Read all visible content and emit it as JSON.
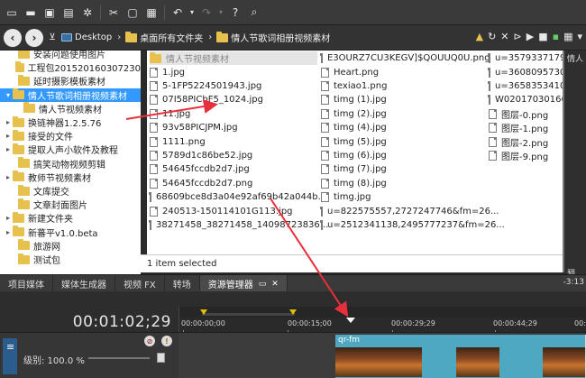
{
  "toolbar": {
    "icons": [
      "new-file-icon",
      "open-icon",
      "save-icon",
      "render-icon",
      "settings-icon",
      "cut-icon",
      "copy-icon",
      "paste-icon",
      "undo-icon",
      "redo-icon",
      "help-icon"
    ]
  },
  "nav": {
    "breadcrumbs": [
      {
        "label": "Desktop",
        "icon": "monitor-icon"
      },
      {
        "label": "桌面所有文件夹",
        "icon": "folder-icon"
      },
      {
        "label": "情人节歌词相册视频素材",
        "icon": "folder-icon"
      }
    ]
  },
  "tree": {
    "items": [
      {
        "label": "安装问题使用图片",
        "indent": 1,
        "arrow": ""
      },
      {
        "label": "工程包2015201603072​30",
        "indent": 1,
        "arrow": ""
      },
      {
        "label": "延时摄影模板素材",
        "indent": 1,
        "arrow": ""
      },
      {
        "label": "情人节歌词相册视频素材",
        "indent": 0,
        "arrow": "▾",
        "selected": true
      },
      {
        "label": "情人节视频素材",
        "indent": 2,
        "arrow": ""
      },
      {
        "label": "换链神器1.2.5.76",
        "indent": 0,
        "arrow": "▸"
      },
      {
        "label": "接受的文件",
        "indent": 0,
        "arrow": "▸"
      },
      {
        "label": "提取人声小软件及教程",
        "indent": 0,
        "arrow": "▸"
      },
      {
        "label": "搞笑动物视频剪辑",
        "indent": 1,
        "arrow": ""
      },
      {
        "label": "教师节视频素材",
        "indent": 0,
        "arrow": "▸"
      },
      {
        "label": "文库提交",
        "indent": 1,
        "arrow": ""
      },
      {
        "label": "文章封面图片",
        "indent": 1,
        "arrow": ""
      },
      {
        "label": "新建文件夹",
        "indent": 0,
        "arrow": "▸"
      },
      {
        "label": "新蕃平v1.0.beta",
        "indent": 0,
        "arrow": "▸"
      },
      {
        "label": "旅游网",
        "indent": 1,
        "arrow": ""
      },
      {
        "label": "测试包",
        "indent": 1,
        "arrow": ""
      }
    ]
  },
  "files": {
    "col1": [
      {
        "name": "情人节视频素材",
        "type": "folder",
        "selected": true
      },
      {
        "name": "1.jpg",
        "type": "file"
      },
      {
        "name": "5-1FP5224501943.jpg",
        "type": "file"
      },
      {
        "name": "07I58PICbF5_1024.jpg",
        "type": "file"
      },
      {
        "name": "11.jpg",
        "type": "file"
      },
      {
        "name": "93v58PICJPM.jpg",
        "type": "file"
      },
      {
        "name": "1111.png",
        "type": "file"
      },
      {
        "name": "5789d1c86be52.jpg",
        "type": "file"
      },
      {
        "name": "54645fccdb2d7.jpg",
        "type": "file"
      },
      {
        "name": "54645fccdb2d7.png",
        "type": "file"
      },
      {
        "name": "68609bce8d3a04e92af69b42a044b...",
        "type": "file"
      },
      {
        "name": "240513-150114101G113.jpg",
        "type": "file"
      },
      {
        "name": "38271458_38271458_14098723836...",
        "type": "file"
      }
    ],
    "col2": [
      {
        "name": "E3OURZ7CU3KEGV]$QOUUQ0U.png",
        "type": "file"
      },
      {
        "name": "Heart.png",
        "type": "file"
      },
      {
        "name": "texiao1.png",
        "type": "file"
      },
      {
        "name": "timg (1).jpg",
        "type": "file"
      },
      {
        "name": "timg (2).jpg",
        "type": "file"
      },
      {
        "name": "timg (4).jpg",
        "type": "file"
      },
      {
        "name": "timg (5).jpg",
        "type": "file"
      },
      {
        "name": "timg (6).jpg",
        "type": "file"
      },
      {
        "name": "timg (7).jpg",
        "type": "file"
      },
      {
        "name": "timg (8).jpg",
        "type": "file"
      },
      {
        "name": "timg.jpg",
        "type": "file"
      },
      {
        "name": "u=822575557,2727247746&fm=26...",
        "type": "file"
      },
      {
        "name": "u=2512341138,2495777237&fm=26...",
        "type": "file"
      }
    ],
    "col3": [
      {
        "name": "u=3579337179,",
        "type": "file"
      },
      {
        "name": "u=3608095730,",
        "type": "file"
      },
      {
        "name": "u=3658353410,",
        "type": "file"
      },
      {
        "name": "W02017030166",
        "type": "file"
      },
      {
        "name": "图层-0.png",
        "type": "file"
      },
      {
        "name": "图层-1.png",
        "type": "file"
      },
      {
        "name": "图层-2.png",
        "type": "file"
      },
      {
        "name": "图层-9.png",
        "type": "file"
      }
    ],
    "status": "1 item selected"
  },
  "right_panel": {
    "label": "情人",
    "bottom_label": "预"
  },
  "tabs": [
    {
      "label": "项目媒体",
      "active": false
    },
    {
      "label": "媒体生成器",
      "active": false
    },
    {
      "label": "视频 FX",
      "active": false
    },
    {
      "label": "转场",
      "active": false
    },
    {
      "label": "资源管理器",
      "active": true
    }
  ],
  "tab_timecode": "-3:13",
  "timeline": {
    "timecode": "00:01:02;29",
    "ruler_labels": [
      "00:00:00;00",
      "00:00:15;00",
      "00:00:29;29",
      "00:00:44;29",
      "00:"
    ],
    "level_label": "级别: 100.0 %",
    "clip_title": "qr-fm"
  },
  "colors": {
    "selection": "#3399ff",
    "clip": "#4ea8c2",
    "annotation": "#e8303c",
    "loop_marker": "#e0c000"
  }
}
